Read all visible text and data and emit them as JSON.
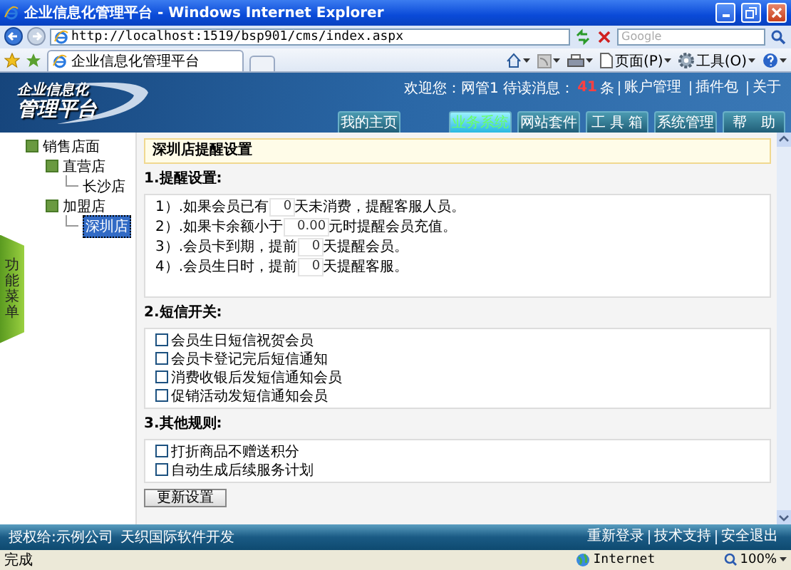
{
  "window": {
    "title": "企业信息化管理平台 - Windows Internet Explorer"
  },
  "browser": {
    "address": "http://localhost:1519/bsp901/cms/index.aspx",
    "search": {
      "placeholder": "Google"
    },
    "tabs": [
      {
        "label": "企业信息化管理平台",
        "selected": true
      }
    ],
    "toolbar": [
      {
        "kind": "home"
      },
      {
        "kind": "feed"
      },
      {
        "kind": "print"
      },
      {
        "kind": "page",
        "label": "页面(P)"
      },
      {
        "kind": "tools",
        "label": "工具(O)"
      },
      {
        "kind": "help"
      }
    ]
  },
  "header": {
    "logo": [
      "企业信息化",
      "管理平台"
    ],
    "greeting": "欢迎您：网管1 待读消息：",
    "unread": "41",
    "unit": "条",
    "links": [
      "账户管理",
      "插件包",
      "关于"
    ],
    "nav": [
      {
        "label": "我的主页",
        "selected": false
      },
      {
        "label": "业务系统",
        "selected": true
      },
      {
        "label": "网站套件",
        "selected": false
      },
      {
        "label": "工 具 箱",
        "selected": false
      },
      {
        "label": "系统管理",
        "selected": false
      },
      {
        "label": "帮　助",
        "selected": false
      }
    ]
  },
  "sidebar": {
    "handle": "功能菜单",
    "tree": [
      {
        "label": "销售店面",
        "selected": false,
        "children": [
          {
            "label": "直营店",
            "selected": false,
            "children": [
              {
                "label": "长沙店",
                "selected": false
              }
            ]
          },
          {
            "label": "加盟店",
            "selected": false,
            "children": [
              {
                "label": "深圳店",
                "selected": true
              }
            ]
          }
        ]
      }
    ]
  },
  "main": {
    "title": "深圳店提醒设置",
    "sections": [
      {
        "heading": "1.提醒设置:",
        "kind": "reminders",
        "rows": [
          {
            "prefix": "1）.如果会员已有",
            "value": "0",
            "suffix": "天未消费，提醒客服人员。"
          },
          {
            "prefix": "2）.如果卡余额小于",
            "value": "0.00",
            "suffix": "元时提醒会员充值。"
          },
          {
            "prefix": "3）.会员卡到期，提前",
            "value": "0",
            "suffix": "天提醒会员。"
          },
          {
            "prefix": "4）.会员生日时，提前",
            "value": "0",
            "suffix": "天提醒客服。"
          }
        ]
      },
      {
        "heading": "2.短信开关:",
        "kind": "checks",
        "items": [
          {
            "label": "会员生日短信祝贺会员",
            "checked": false
          },
          {
            "label": "会员卡登记完后短信通知",
            "checked": false
          },
          {
            "label": "消费收银后发短信通知会员",
            "checked": false
          },
          {
            "label": "促销活动发短信通知会员",
            "checked": false
          }
        ]
      },
      {
        "heading": "3.其他规则:",
        "kind": "checks",
        "items": [
          {
            "label": "打折商品不赠送积分",
            "checked": false
          },
          {
            "label": "自动生成后续服务计划",
            "checked": false
          }
        ]
      }
    ],
    "button": "更新设置"
  },
  "footer": {
    "left": [
      "授权给:示例公司",
      "天织国际软件开发"
    ],
    "links": [
      "重新登录",
      "技术支持",
      "安全退出"
    ]
  },
  "status_bar": {
    "text": "完成",
    "zone": "Internet",
    "zoom": "100%"
  }
}
